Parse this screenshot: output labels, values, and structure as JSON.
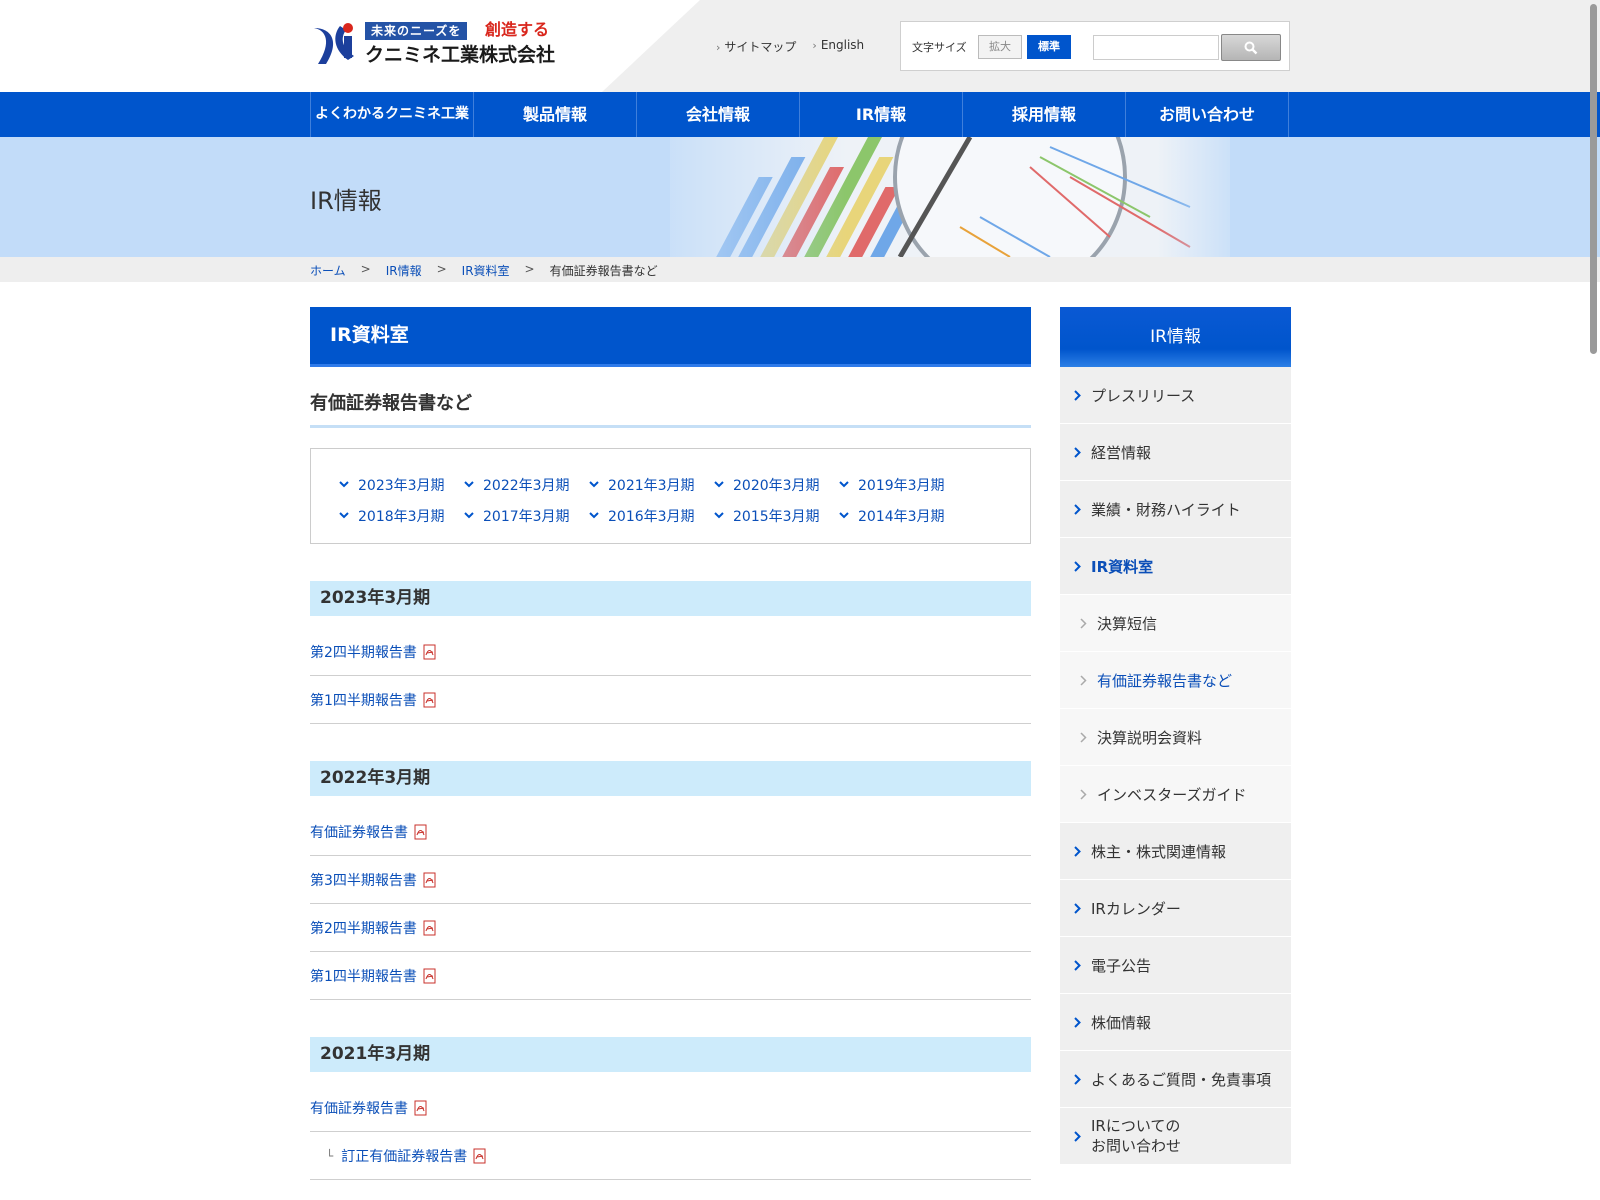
{
  "header": {
    "logo_tag": "未来のニーズを",
    "logo_tag_red": "創造する",
    "logo_name": "クニミネ工業株式会社",
    "util_links": [
      {
        "label": "サイトマップ"
      },
      {
        "label": "English"
      }
    ],
    "font_size_label": "文字サイズ",
    "font_size_large": "拡大",
    "font_size_standard": "標準",
    "search_placeholder": ""
  },
  "gnav": [
    {
      "label": "よくわかるクニミネ工業"
    },
    {
      "label": "製品情報"
    },
    {
      "label": "会社情報"
    },
    {
      "label": "IR情報"
    },
    {
      "label": "採用情報"
    },
    {
      "label": "お問い合わせ"
    }
  ],
  "banner": {
    "title": "IR情報"
  },
  "breadcrumb": {
    "items": [
      "ホーム",
      "IR情報",
      "IR資料室"
    ],
    "current": "有価証券報告書など"
  },
  "main": {
    "section_title": "IR資料室",
    "page_title": "有価証券報告書など",
    "year_links": [
      [
        "2023年3月期",
        "2022年3月期",
        "2021年3月期",
        "2020年3月期",
        "2019年3月期"
      ],
      [
        "2018年3月期",
        "2017年3月期",
        "2016年3月期",
        "2015年3月期",
        "2014年3月期"
      ]
    ],
    "years": [
      {
        "heading": "2023年3月期",
        "docs": [
          "第2四半期報告書",
          "第1四半期報告書"
        ]
      },
      {
        "heading": "2022年3月期",
        "docs": [
          "有価証券報告書",
          "第3四半期報告書",
          "第2四半期報告書",
          "第1四半期報告書"
        ]
      },
      {
        "heading": "2021年3月期",
        "docs": [
          "有価証券報告書"
        ],
        "sub_docs": [
          "訂正有価証券報告書"
        ]
      }
    ]
  },
  "side": {
    "title": "IR情報",
    "items": [
      "プレスリリース",
      "経営情報",
      "業績・財務ハイライト",
      "IR資料室",
      "決算短信",
      "有価証券報告書など",
      "決算説明会資料",
      "インベスターズガイド",
      "株主・株式関連情報",
      "IRカレンダー",
      "電子公告",
      "株価情報",
      "よくあるご質問・免責事項"
    ],
    "last_item_line1": "IRについての",
    "last_item_line2": "お問い合わせ"
  },
  "colors": {
    "primary": "#0055cc",
    "link": "#0b4fb8",
    "year_band": "#cdebfb",
    "banner_bg": "#c2dcf9"
  }
}
